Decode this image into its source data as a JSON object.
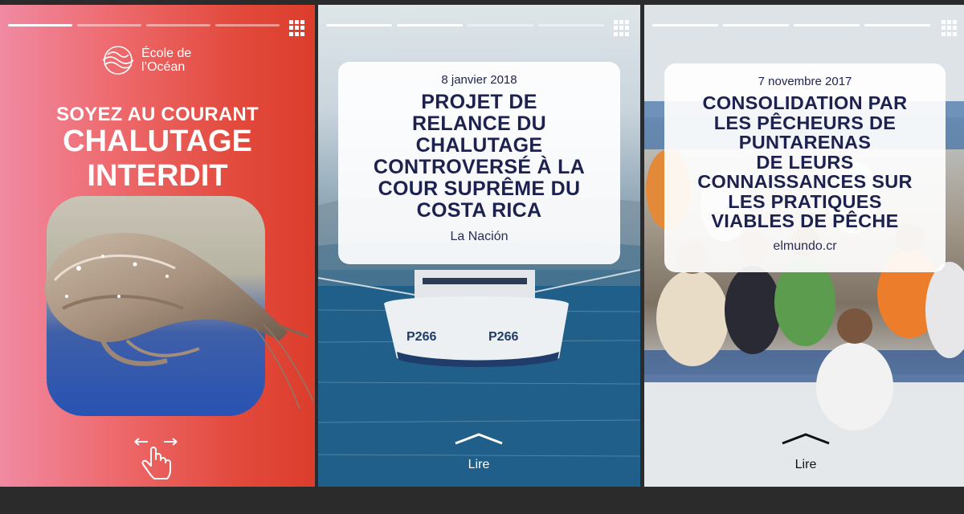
{
  "panels": [
    {
      "logo": {
        "line1": "École de",
        "line2": "l’Océan"
      },
      "headline": {
        "line1": "SOYEZ AU COURANT",
        "line2": "CHALUTAGE",
        "line3": "INTERDIT"
      },
      "progress": {
        "total": 4,
        "completed": 1
      },
      "colors": {
        "gradient_left": "#f08aa3",
        "gradient_right": "#dc3d2c"
      }
    },
    {
      "date": "8 janvier 2018",
      "headline_lines": [
        "PROJET DE",
        "RELANCE DU",
        "CHALUTAGE",
        "CONTROVERSÉ À LA",
        "COUR SUPRÊME DU",
        "COSTA RICA"
      ],
      "source": "La Nación",
      "read_label": "Lire",
      "progress": {
        "total": 4,
        "completed": 2
      },
      "boat_label_left": "P266",
      "boat_label_right": "P266"
    },
    {
      "date": "7 novembre 2017",
      "headline_lines": [
        "CONSOLIDATION PAR",
        "LES PÊCHEURS DE",
        "PUNTARENAS",
        "DE LEURS",
        "CONNAISSANCES SUR",
        "LES PRATIQUES",
        "VIABLES DE PÊCHE"
      ],
      "source": "elmundo.cr",
      "read_label": "Lire",
      "progress": {
        "total": 4,
        "completed": 4
      }
    }
  ],
  "icons": {
    "menu": "grid-icon",
    "swipe": "swipe-hand-icon",
    "read": "chevron-up-icon",
    "logo": "ecole-ocean-logo"
  },
  "colors": {
    "headline_text": "#1d2150",
    "card_bg": "#ffffff",
    "background": "#2b2b2b"
  }
}
